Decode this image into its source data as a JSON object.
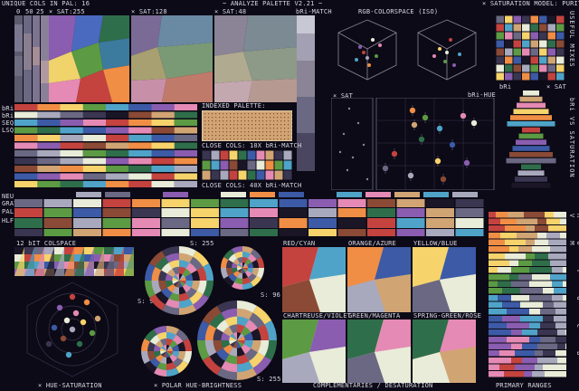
{
  "header": {
    "unique_cols": "UNIQUE COLS IN PAL: 16",
    "title": "~ ANALYZE PALETTE V2.21 ~",
    "model": "× SATURATION MODEL: PURITY",
    "sat_labels": [
      "0",
      "50",
      "25",
      "× SAT:255",
      "× SAT:128",
      "× SAT:48",
      "bRi-MATCH"
    ],
    "rgb_space": "RGB-COLORSPACE (ISO)"
  },
  "left_labels": [
    "bRi",
    "bRi",
    "SEQ",
    "LSQ",
    "NEU",
    "GRAY",
    "PAL",
    "HLF"
  ],
  "mid": {
    "indexed": "INDEXED PALETTE:",
    "close1": "CLOSE COLS: 10X bRi-MATCH",
    "close2": "CLOSE COLS: 40X bRi-MATCH",
    "xsat": "× SAT",
    "brihue": "bRi-HUE",
    "bri": "bRi",
    "xsat2": "× SAT"
  },
  "right_vertical": {
    "useful": "USEFUL MIXES",
    "bri_sat": "bRi VS SATURATION",
    "roygcbvm": "R O Y G C B V M"
  },
  "lower": {
    "colspace": "12 bIT COLSPACE",
    "s255a": "S: 255",
    "s96a": "S: 96",
    "s96b": "S: 96",
    "s255b": "S: 255",
    "pairs": [
      "RED/CYAN",
      "ORANGE/AZURE",
      "YELLOW/BLUE",
      "CHARTREUSE/VIOLET",
      "GREEN/MAGENTA",
      "SPRING-GREEN/ROSE"
    ]
  },
  "footer": {
    "hue_sat": "× HUE-SATURATION",
    "polar": "× POLAR HUE-BRIGHTNESS",
    "complementaries": "COMPLEMENTARIES / DESATURATION",
    "primary": "PRIMARY RANGES"
  },
  "palette": [
    "#1a1626",
    "#3a3550",
    "#6a6882",
    "#a9a9bd",
    "#e8ecd8",
    "#c4433f",
    "#f08e45",
    "#f6d36b",
    "#5c9a43",
    "#2f6e4a",
    "#4fa3c8",
    "#3c5aa6",
    "#8a5db0",
    "#e58ab4",
    "#8a4a35",
    "#d1a474"
  ]
}
